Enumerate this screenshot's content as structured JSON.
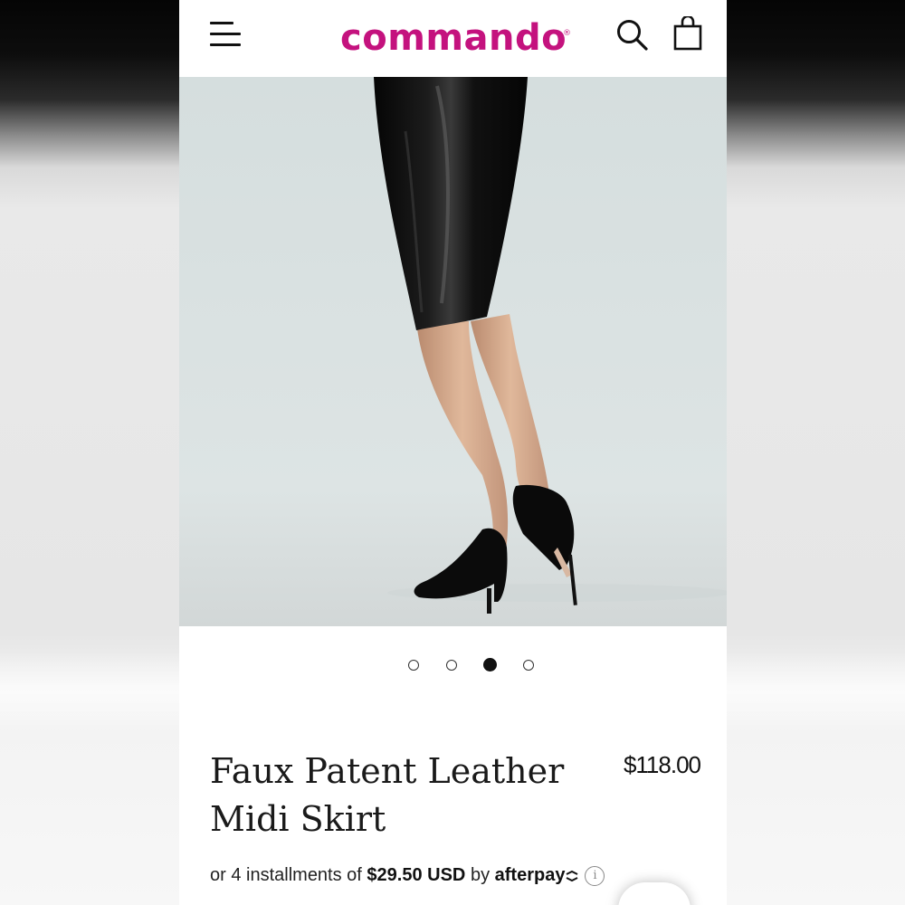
{
  "brand": {
    "name": "commando",
    "registered_mark": "®",
    "color": "#c4127e"
  },
  "header": {
    "menu_icon": "hamburger-menu-icon",
    "search_icon": "search-icon",
    "cart_icon": "shopping-bag-icon"
  },
  "gallery": {
    "image_count": 4,
    "active_index": 2
  },
  "product": {
    "title_line1": "Faux Patent Leather",
    "title_line2": "Midi Skirt",
    "price": "$118.00"
  },
  "afterpay": {
    "prefix": "or 4 installments of",
    "amount": "$29.50 USD",
    "by": "by",
    "provider": "afterpay",
    "info_icon": "i"
  }
}
